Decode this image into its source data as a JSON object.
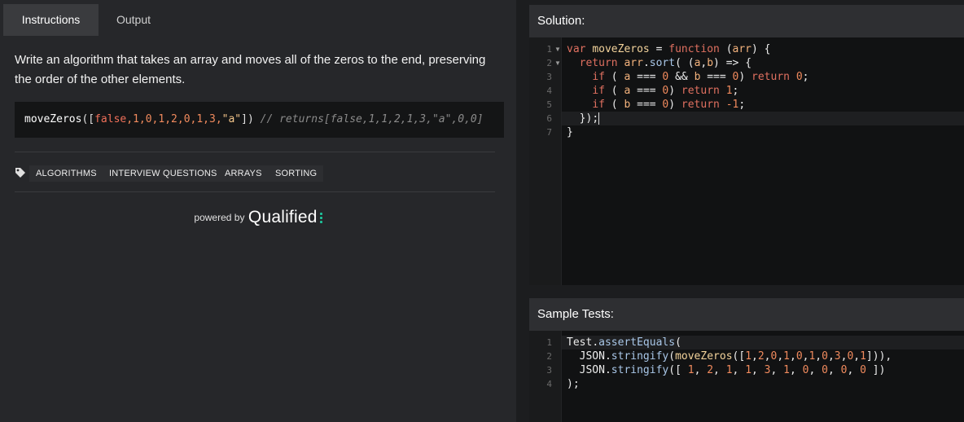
{
  "tabs": {
    "instructions": "Instructions",
    "output": "Output"
  },
  "instructions": {
    "description": "Write an algorithm that takes an array and moves all of the zeros to the end, preserving the order of the other elements.",
    "example": {
      "fn": "moveZeros",
      "open": "([",
      "kw_false": "false",
      "nums": ",1,0,1,2,0,1,3,",
      "str": "\"a\"",
      "close": "])",
      "comment": "// returns[false,1,1,2,1,3,\"a\",0,0]"
    },
    "tags": [
      "ALGORITHMS",
      "INTERVIEW QUESTIONS",
      "ARRAYS",
      "SORTING"
    ],
    "powered_by": "powered by",
    "brand": "Qualified"
  },
  "solution": {
    "title": "Solution:",
    "line_numbers": [
      "1",
      "2",
      "3",
      "4",
      "5",
      "6",
      "7"
    ],
    "lines": [
      "var moveZeros = function (arr) {",
      "  return arr.sort( (a,b) => {",
      "    if ( a === 0 && b === 0) return 0;",
      "    if ( a === 0) return 1;",
      "    if ( b === 0) return -1;",
      "  });",
      "}"
    ]
  },
  "sample_tests": {
    "title": "Sample Tests:",
    "line_numbers": [
      "1",
      "2",
      "3",
      "4"
    ],
    "lines": [
      "Test.assertEquals(",
      "  JSON.stringify(moveZeros([1,2,0,1,0,1,0,3,0,1])),",
      "  JSON.stringify([ 1, 2, 1, 1, 3, 1, 0, 0, 0, 0 ])",
      ");"
    ]
  },
  "colors": {
    "accent_red": "#d5664f",
    "brand_green": "#1ec29a",
    "background": "#1c1d1f"
  }
}
